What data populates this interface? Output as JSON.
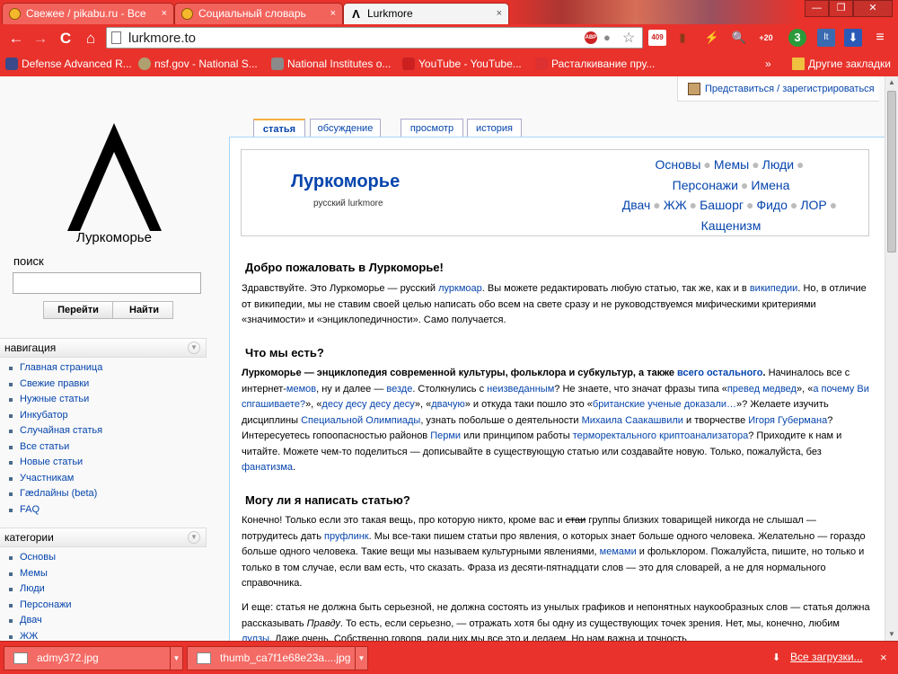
{
  "tabs": [
    {
      "title": "Свежее / pikabu.ru - Все",
      "close": "×"
    },
    {
      "title": "Социальный словарь",
      "close": "×"
    },
    {
      "title": "Lurkmore",
      "icon": "Λ",
      "close": "×"
    }
  ],
  "window_controls": [
    "—",
    "❐",
    "✕"
  ],
  "nav_icons": {
    "back": "←",
    "forward": "→",
    "reload": "C",
    "home": "⌂"
  },
  "omnibox": {
    "url": "lurkmore.to",
    "abp": "ABP"
  },
  "extensions": [
    {
      "name": "mail-badge-icon",
      "label": "409"
    },
    {
      "name": "lightning-icon",
      "label": "⚡"
    },
    {
      "name": "magnifier-icon",
      "label": "🔍"
    },
    {
      "name": "weather-badge-icon",
      "label": "+20"
    },
    {
      "name": "green-badge-icon",
      "label": "3"
    },
    {
      "name": "lt-icon",
      "label": "lt"
    },
    {
      "name": "download-ext-icon",
      "label": "⬇"
    },
    {
      "name": "menu-icon",
      "label": "≡"
    }
  ],
  "bookmarks": [
    {
      "label": "Defense Advanced R...",
      "color": "#3a4a8a"
    },
    {
      "label": "nsf.gov - National S...",
      "color": "#b0a070"
    },
    {
      "label": "National Institutes o...",
      "color": "#8a8a8a"
    },
    {
      "label": "YouTube - YouTube...",
      "color": "#cc2020"
    },
    {
      "label": "Расталкивание пру...",
      "color": "#dd3030"
    }
  ],
  "bookmarks_overflow": "»",
  "other_bookmarks": "Другие закладки",
  "login_link": "Представиться / зарегистрироваться",
  "logo": {
    "glyph": "Λ",
    "caption": "Луркоморье"
  },
  "search": {
    "heading": "поиск",
    "go": "Перейти",
    "find": "Найти",
    "value": ""
  },
  "navigation": {
    "heading": "навигация",
    "items": [
      "Главная страница",
      "Свежие правки",
      "Нужные статьи",
      "Инкубатор",
      "Случайная статья",
      "Все статьи",
      "Новые статьи",
      "Участникам",
      "Гædлайны (beta)",
      "FAQ"
    ]
  },
  "categories": {
    "heading": "категории",
    "items": [
      "Основы",
      "Мемы",
      "Люди",
      "Персонажи",
      "Двач",
      "ЖЖ"
    ]
  },
  "page_tabs": [
    "статья",
    "обсуждение",
    "просмотр",
    "история"
  ],
  "header": {
    "title": "Луркоморье",
    "subtitle": "русский lurkmore",
    "row1": [
      "Основы",
      "Мемы",
      "Люди"
    ],
    "row2": [
      "Персонажи",
      "Имена"
    ],
    "row3": [
      "Двач",
      "ЖЖ",
      "Башорг",
      "Фидо",
      "ЛОР"
    ],
    "row4": [
      "Кащенизм"
    ]
  },
  "sections": [
    {
      "heading": "Добро пожаловать в Луркоморье!",
      "p1": "Здравствуйте. Это Луркоморье — русский ",
      "l1": "луркмоар",
      "p2": ". Вы можете редактировать любую статью, так же, как и в ",
      "l2": "википедии",
      "p3": ". Но, в отличие от википедии, мы не ставим своей целью написать обо всем на свете сразу и не руководствуемся мифическими критериями «значимости» и «энциклопедичности». Само получается."
    },
    {
      "heading": "Что мы есть?",
      "b1": "Луркоморье — энциклопедия современной культуры, фольклора и субкультур, а также ",
      "bl1": "всего остального",
      "b2": ". ",
      "p1": "Начиналось все с интернет-",
      "l1": "мемов",
      "p2": ", ну и далее — ",
      "l2": "везде",
      "p3": ". Столкнулись с ",
      "l3": "неизведанным",
      "p4": "? Не знаете, что значат фразы типа «",
      "l4": "превед медвед",
      "p5": "», «",
      "l5": "а почему Ви спгашиваете?",
      "p6": "», «",
      "l6": "десу десу десу десу",
      "p7": "», «",
      "l7": "двачую",
      "p8": "» и откуда таки пошло это «",
      "l8": "британские ученые доказали…",
      "p9": "»? Желаете изучить дисциплины ",
      "l9": "Специальной Олимпиады",
      "p10": ", узнать побольше о деятельности ",
      "l10": "Михаила Саакашвили",
      "p11": " и творчестве ",
      "l11": "Игоря Губермана",
      "p12": "? Интересуетесь гопоопасностью районов ",
      "l12": "Перми",
      "p13": " или принципом работы ",
      "l13": "терморектального криптоанализатора",
      "p14": "? Приходите к нам и читайте. Можете чем-то поделиться — дописывайте в существующую статью или создавайте новую. Только, пожалуйста, без ",
      "l14": "фанатизма",
      "p15": "."
    },
    {
      "heading": "Могу ли я написать статью?",
      "p1": "Конечно! Только если это такая вещь, про которую никто, кроме вас и ",
      "s1": "стаи",
      "p2": " группы близких товарищей никогда не слышал — потрудитесь дать ",
      "l1": "пруфлинк",
      "p3": ". Мы все-таки пишем статьи про явления, о которых знает больше одного человека. Желательно — гораздо больше одного человека. Такие вещи мы называем культурными явлениями, ",
      "l2": "мемами",
      "p4": " и фольклором. Пожалуйста, пишите, но только и только в том случае, если вам есть, что сказать. Фраза из десяти-пятнадцати слов — это для словарей, а не для нормального справочника.",
      "q1": "И еще: статья не должна быть серьезной, не должна состоять из унылых графиков и непонятных наукообразных слов — статья должна рассказывать ",
      "qi": "Правду",
      "q2": ". То есть, если серьезно, — отражать хотя бы одну из существующих точек зрения. Нет, мы, конечно, любим ",
      "ql": "лулзы",
      "q3": ". Даже очень. Собственно говоря, ради них мы все это и делаем. Но нам важна и точность"
    }
  ],
  "downloads": {
    "items": [
      "admy372.jpg",
      "thumb_ca7f1e68e23a....jpg"
    ],
    "all": "Все загрузки...",
    "close": "×"
  }
}
